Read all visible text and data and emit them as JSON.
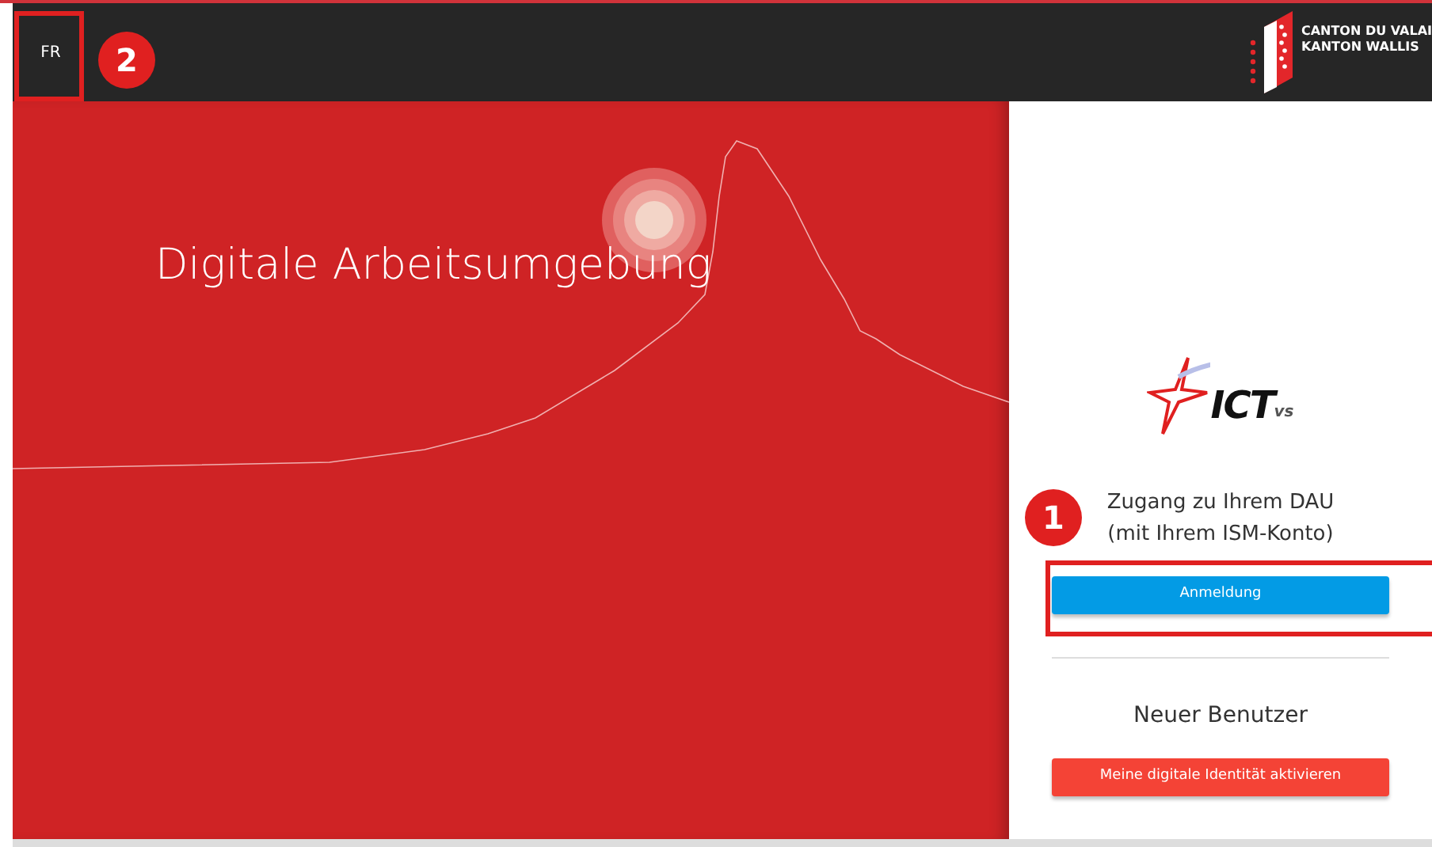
{
  "header": {
    "language_button": "FR",
    "logo_text": [
      "CANTON DU VALAI",
      "KANTON WALLIS"
    ]
  },
  "hero": {
    "title": "Digitale Arbeitsumgebung"
  },
  "login_panel": {
    "logo_text": "ICT",
    "logo_suffix": "vs",
    "access_text": [
      "Zugang zu Ihrem DAU",
      "(mit Ihrem ISM-Konto)"
    ],
    "login_button": "Anmeldung",
    "new_user_heading": "Neuer Benutzer",
    "activate_button": "Meine digitale Identität aktivieren"
  },
  "annotations": [
    {
      "label": "2",
      "kind": "language"
    },
    {
      "label": "1",
      "kind": "login"
    }
  ]
}
